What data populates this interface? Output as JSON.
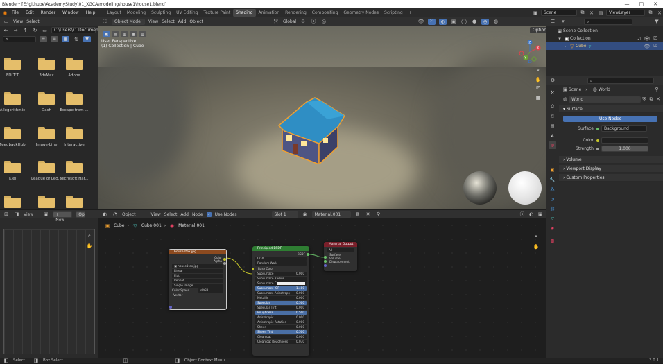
{
  "window": {
    "title": "Blender* [E:\\githube\\AcademyStudy\\01_XGCA\\modeling\\house1\\house1.blend]",
    "controls": [
      "—",
      "□",
      "✕"
    ]
  },
  "topbar": {
    "menus": [
      "File",
      "Edit",
      "Render",
      "Window",
      "Help"
    ],
    "workspaces": [
      "Layout",
      "Modeling",
      "Sculpting",
      "UV Editing",
      "Texture Paint",
      "Shading",
      "Animation",
      "Rendering",
      "Compositing",
      "Geometry Nodes",
      "Scripting",
      "+"
    ],
    "active_workspace": "Shading",
    "scene": "Scene",
    "view_layer": "ViewLayer"
  },
  "file_browser": {
    "menus": [
      "View",
      "Select"
    ],
    "path": "C:\\Users\\C..Documents\\",
    "folders": [
      "FDLT'T",
      "3dsMax",
      "Adobe",
      "Allegorithmic",
      "Dash",
      "Escape from ...",
      "FeedbackHub",
      "Image-Line",
      "Interactive",
      "Klei",
      "League of Leg...",
      "Microsoft Har...",
      "",
      "",
      ""
    ]
  },
  "viewport": {
    "mode": "Object Mode",
    "menus": [
      "View",
      "Select",
      "Add",
      "Object"
    ],
    "transform": "Global",
    "options": "Options",
    "overlay_line1": "User Perspective",
    "overlay_line2": "(1) Collection | Cube",
    "gizmo": {
      "x": "X",
      "y": "Y",
      "z": "Z"
    }
  },
  "outliner": {
    "items": [
      {
        "label": "Scene Collection"
      },
      {
        "label": "Collection"
      },
      {
        "label": "Cube"
      }
    ]
  },
  "properties": {
    "breadcrumb": [
      "Scene",
      "World"
    ],
    "world_name": "World",
    "surface_panel": "Surface",
    "use_nodes_label": "Use Nodes",
    "surface_label": "Surface",
    "surface_value": "Background",
    "color_label": "Color",
    "strength_label": "Strength",
    "strength_value": "1.000",
    "panels": [
      "Volume",
      "Viewport Display",
      "Custom Properties"
    ]
  },
  "uv_editor": {
    "menus": [
      "View"
    ],
    "new_label": "New",
    "open_label": "Ope"
  },
  "node_editor": {
    "type": "Object",
    "menus": [
      "View",
      "Select",
      "Add",
      "Node"
    ],
    "use_nodes": "Use Nodes",
    "slot": "Slot 1",
    "material": "Material.001",
    "breadcrumb": [
      "Cube",
      "Cube.001",
      "Material.001"
    ]
  },
  "nodes": {
    "image": {
      "title": "house1tex.jpg",
      "outputs": [
        "Color",
        "Alpha"
      ],
      "file": "house1tex.jpg",
      "fields": [
        "Linear",
        "Flat",
        "Repeat",
        "Single Image"
      ],
      "colorspace_label": "Color Space",
      "colorspace": "sRGB",
      "vector": "Vector"
    },
    "bsdf": {
      "title": "Principled BSDF",
      "output": "BSDF",
      "dropdowns": [
        "GGX",
        "Random Walk"
      ],
      "inputs": [
        {
          "label": "Base Color",
          "value": ""
        },
        {
          "label": "Subsurface",
          "value": "0.000"
        },
        {
          "label": "Subsurface Radius",
          "value": ""
        },
        {
          "label": "Subsurface Co...",
          "value": ""
        },
        {
          "label": "Subsurface IOR",
          "value": "1.400"
        },
        {
          "label": "Subsurface Anisotropy",
          "value": "0.000"
        },
        {
          "label": "Metallic",
          "value": "0.000"
        },
        {
          "label": "Specular",
          "value": "0.500"
        },
        {
          "label": "Specular Tint",
          "value": "0.000"
        },
        {
          "label": "Roughness",
          "value": "0.500"
        },
        {
          "label": "Anisotropic",
          "value": "0.000"
        },
        {
          "label": "Anisotropic Rotation",
          "value": "0.000"
        },
        {
          "label": "Sheen",
          "value": "0.000"
        },
        {
          "label": "Sheen Tint",
          "value": "0.500"
        },
        {
          "label": "Clearcoat",
          "value": "0.000"
        },
        {
          "label": "Clearcoat Roughness",
          "value": "0.030"
        }
      ]
    },
    "output": {
      "title": "Material Output",
      "target": "All",
      "inputs": [
        "Surface",
        "Volume",
        "Displacement"
      ]
    }
  },
  "statusbar": {
    "items": [
      "Select",
      "Box Select",
      "Object Context Menu"
    ],
    "version": "3.0.1"
  },
  "colors": {
    "accent": "#4772b3",
    "image_node": "#8c4a1f",
    "bsdf_node": "#2e7d32",
    "output_node": "#7a1f2a",
    "link": "#c7c729",
    "folder": "#e5be6a"
  }
}
